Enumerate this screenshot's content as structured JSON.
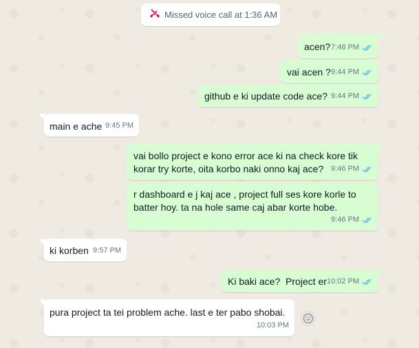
{
  "system_message": {
    "icon": "missed-call-icon",
    "text": "Missed voice call at 1:36 AM",
    "color": "#ea0038"
  },
  "messages": [
    {
      "direction": "out",
      "text": "acen?",
      "time": "7:48 PM",
      "status": "read"
    },
    {
      "direction": "out",
      "text": "vai acen ?",
      "time": "9:44 PM",
      "status": "read"
    },
    {
      "direction": "out",
      "text": "github e ki update code ace?",
      "time": "9:44 PM",
      "status": "read"
    },
    {
      "direction": "in",
      "text": "main e ache",
      "time": "9:45 PM"
    },
    {
      "direction": "out",
      "text": "vai bollo project e kono error ace ki na check kore tik\nkorar try korte, oita korbo naki onno kaj ace?",
      "time": "9:46 PM",
      "status": "read"
    },
    {
      "direction": "out",
      "text": "r dashboard e j kaj ace , project full ses kore korle to\nbatter hoy. ta na hole same caj abar korte hobe.",
      "time": "9:46 PM",
      "status": "read"
    },
    {
      "direction": "in",
      "text": "ki korben",
      "time": "9:57 PM"
    },
    {
      "direction": "out",
      "text": "Ki baki ace?  Project er",
      "time": "10:02 PM",
      "status": "read"
    },
    {
      "direction": "in",
      "text": "pura project ta tei problem ache. last e ter pabo shobai.",
      "time": "10:03 PM"
    }
  ],
  "reaction_button": {
    "icon": "emoji-reaction-icon"
  },
  "colors": {
    "outgoing_bubble": "#d9fdd3",
    "incoming_bubble": "#ffffff",
    "read_ticks": "#53bdeb",
    "background": "#efeae2"
  }
}
